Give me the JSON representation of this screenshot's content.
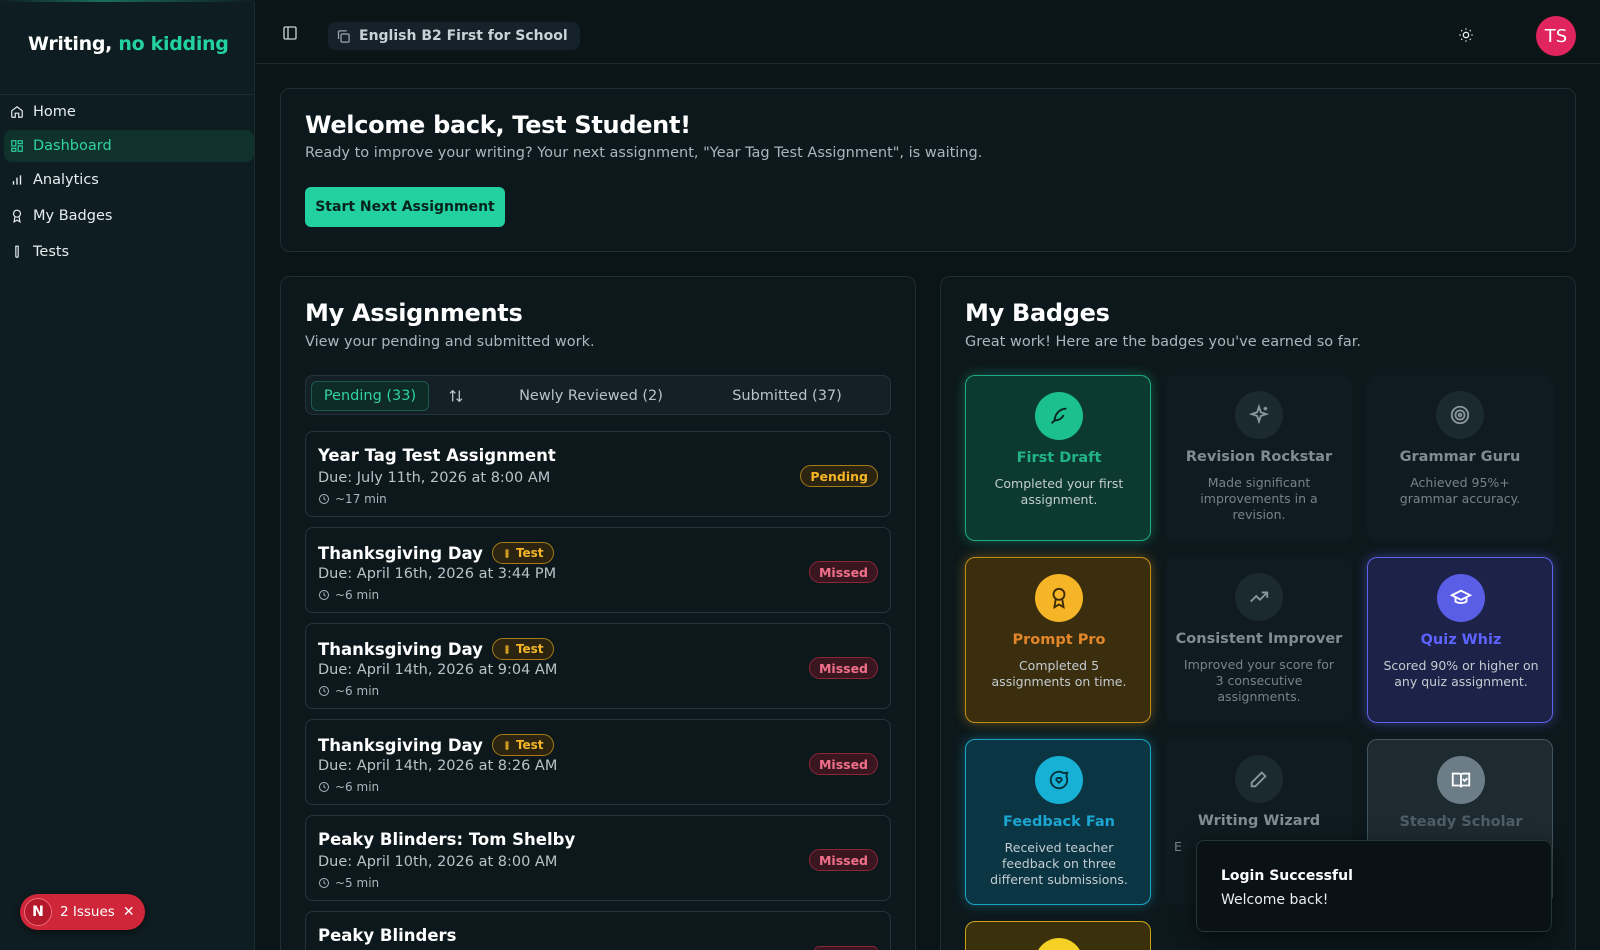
{
  "app": {
    "logo_main": "Writing,",
    "logo_accent": "no kidding"
  },
  "sidebar": {
    "items": [
      {
        "label": "Home",
        "icon": "home-icon"
      },
      {
        "label": "Dashboard",
        "icon": "dashboard-grid-icon",
        "active": true
      },
      {
        "label": "Analytics",
        "icon": "bar-chart-icon"
      },
      {
        "label": "My Badges",
        "icon": "award-icon"
      },
      {
        "label": "Tests",
        "icon": "test-tube-icon"
      }
    ]
  },
  "issues": {
    "initial": "N",
    "label": "2 Issues"
  },
  "topbar": {
    "course": "English B2 First for School",
    "avatar_initials": "TS"
  },
  "welcome": {
    "title": "Welcome back, Test Student!",
    "subtitle": "Ready to improve your writing? Your next assignment, \"Year Tag Test Assignment\", is waiting.",
    "button": "Start Next Assignment"
  },
  "assignments": {
    "title": "My Assignments",
    "subtitle": "View your pending and submitted work.",
    "tabs": {
      "pending": "Pending (33)",
      "reviewed": "Newly Reviewed (2)",
      "submitted": "Submitted (37)"
    },
    "test_tag": "Test",
    "items": [
      {
        "title": "Year Tag Test Assignment",
        "due": "Due: July 11th, 2026 at 8:00 AM",
        "duration": "~17 min",
        "status": "Pending",
        "is_test": false
      },
      {
        "title": "Thanksgiving Day",
        "due": "Due: April 16th, 2026 at 3:44 PM",
        "duration": "~6 min",
        "status": "Missed",
        "is_test": true
      },
      {
        "title": "Thanksgiving Day",
        "due": "Due: April 14th, 2026 at 9:04 AM",
        "duration": "~6 min",
        "status": "Missed",
        "is_test": true
      },
      {
        "title": "Thanksgiving Day",
        "due": "Due: April 14th, 2026 at 8:26 AM",
        "duration": "~6 min",
        "status": "Missed",
        "is_test": true
      },
      {
        "title": "Peaky Blinders: Tom Shelby",
        "due": "Due: April 10th, 2026 at 8:00 AM",
        "duration": "~5 min",
        "status": "Missed",
        "is_test": false
      },
      {
        "title": "Peaky Blinders",
        "due": "",
        "duration": "",
        "status": "",
        "is_test": false
      }
    ]
  },
  "badges": {
    "title": "My Badges",
    "subtitle": "Great work! Here are the badges you've earned so far.",
    "items": [
      {
        "name": "First Draft",
        "desc": "Completed your first assignment.",
        "earned": true,
        "color": "#1cbf8e",
        "icon": "feather-icon"
      },
      {
        "name": "Revision Rockstar",
        "desc": "Made significant improvements in a revision.",
        "earned": false,
        "icon": "sparkles-icon"
      },
      {
        "name": "Grammar Guru",
        "desc": "Achieved 95%+ grammar accuracy.",
        "earned": false,
        "icon": "target-icon"
      },
      {
        "name": "Prompt Pro",
        "desc": "Completed 5 assignments on time.",
        "earned": true,
        "color": "#f5b526",
        "icon": "award-icon"
      },
      {
        "name": "Consistent Improver",
        "desc": "Improved your score for 3 consecutive assignments.",
        "earned": false,
        "icon": "trending-up-icon"
      },
      {
        "name": "Quiz Whiz",
        "desc": "Scored 90% or higher on any quiz assignment.",
        "earned": true,
        "color": "#5a5ee6",
        "icon": "graduation-cap-icon"
      },
      {
        "name": "Feedback Fan",
        "desc": "Received teacher feedback on three different submissions.",
        "earned": true,
        "color": "#18b1d6",
        "icon": "message-heart-icon"
      },
      {
        "name": "Writing Wizard",
        "desc": "E",
        "earned": false,
        "icon": "pen-icon"
      },
      {
        "name": "Steady Scholar",
        "desc": "",
        "earned": true,
        "color": "#6c7d87",
        "icon": "book-check-icon"
      }
    ]
  },
  "toast": {
    "title": "Login Successful",
    "message": "Welcome back!"
  }
}
